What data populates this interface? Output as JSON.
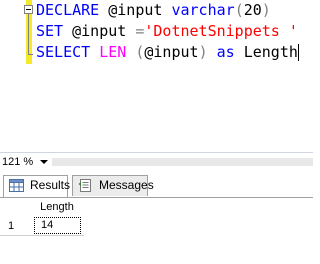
{
  "editor": {
    "line1": {
      "kw1": "DECLARE",
      "var": " @input ",
      "type": "varchar",
      "open": "(",
      "num": "20",
      "close": ")"
    },
    "line2": {
      "kw": "SET",
      "var": " @input ",
      "op": "=",
      "str": "'DotnetSnippets '"
    },
    "line3": {
      "kw": "SELECT",
      "fn": " LEN ",
      "open": "(",
      "var": "@input",
      "close": ")",
      "as": " as",
      "alias": " Length"
    }
  },
  "zoom": {
    "value": "121 %"
  },
  "tabs": [
    {
      "label": "Results",
      "icon": "grid-icon"
    },
    {
      "label": "Messages",
      "icon": "messages-icon"
    }
  ],
  "grid": {
    "columns": [
      "Length"
    ],
    "rows": [
      {
        "row_number": "1",
        "cells": [
          "14"
        ]
      }
    ]
  },
  "colors": {
    "keyword": "#0000ff",
    "function": "#ff00ff",
    "string": "#ff0000",
    "change_bar": "#f5ea2a"
  }
}
